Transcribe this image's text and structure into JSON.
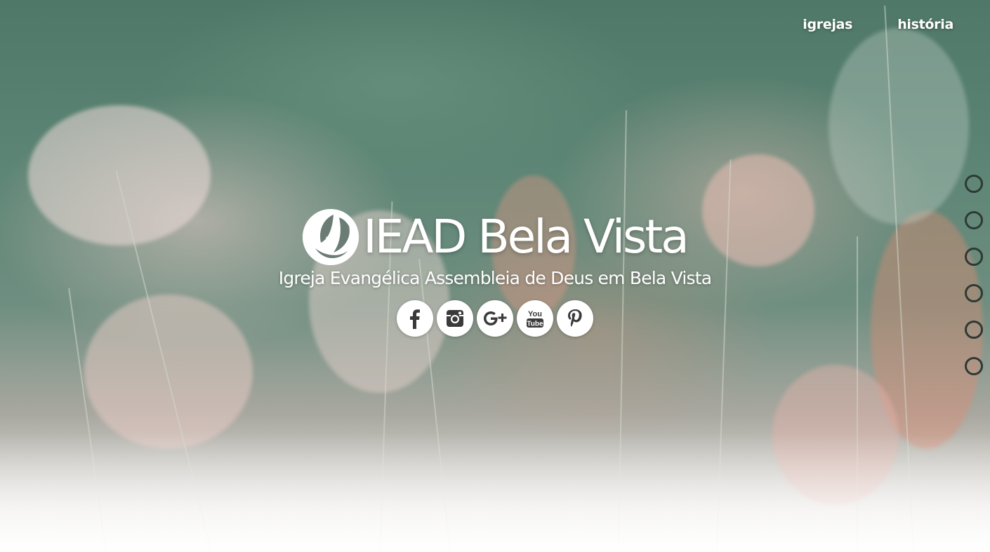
{
  "nav": {
    "items": [
      {
        "label": "igrejas"
      },
      {
        "label": "história"
      }
    ]
  },
  "brand": {
    "title": "IEAD Bela Vista",
    "subtitle": "Igreja Evangélica Assembleia de Deus em Bela Vista"
  },
  "social": {
    "items": [
      {
        "icon": "facebook-icon"
      },
      {
        "icon": "instagram-icon"
      },
      {
        "icon": "google-plus-icon"
      },
      {
        "icon": "youtube-icon"
      },
      {
        "icon": "pinterest-icon"
      }
    ],
    "icon_color": "#3a3a3a"
  },
  "section_nav": {
    "count": 6,
    "color": "#2d3a34"
  }
}
